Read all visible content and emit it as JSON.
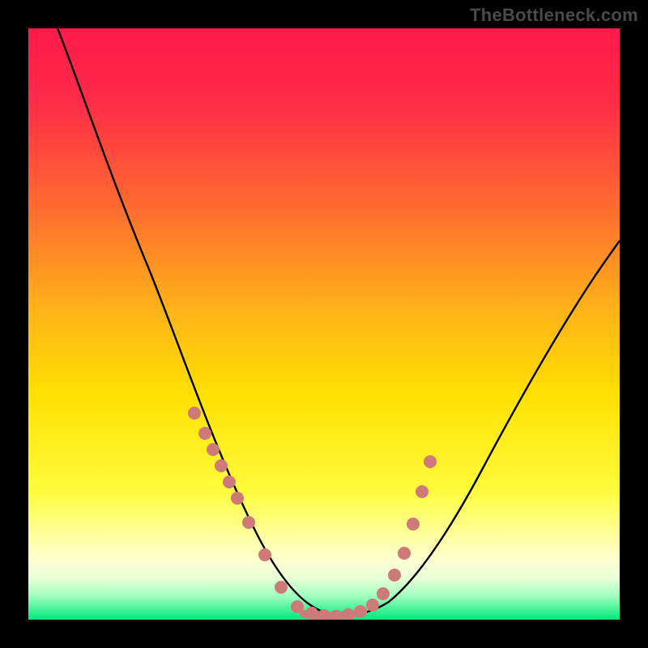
{
  "watermark": "TheBottleneck.com",
  "colors": {
    "background": "#000000",
    "gradient_top": "#ff1a4a",
    "gradient_mid": "#ffd400",
    "gradient_low": "#ffff8a",
    "gradient_bottom": "#00e87a",
    "curve": "#000000",
    "dot": "#cd7a78"
  },
  "chart_data": {
    "type": "line",
    "title": "",
    "xlabel": "",
    "ylabel": "",
    "xlim": [
      0,
      100
    ],
    "ylim": [
      0,
      100
    ],
    "series": [
      {
        "name": "bottleneck-curve",
        "x": [
          5,
          8,
          12,
          16,
          20,
          24,
          28,
          30,
          32,
          34,
          36,
          38,
          40,
          42,
          44,
          46,
          48,
          50,
          52,
          54,
          56,
          58,
          62,
          66,
          70,
          75,
          80,
          85,
          90,
          95,
          100
        ],
        "y": [
          100,
          94,
          86,
          78,
          70,
          62,
          52,
          47,
          42,
          36,
          30,
          24,
          18,
          12,
          7,
          3,
          1,
          0,
          0,
          0,
          1,
          3,
          8,
          14,
          21,
          30,
          39,
          47,
          54,
          60,
          65
        ]
      }
    ],
    "scatter_points": {
      "name": "highlight-dots",
      "x": [
        28,
        30,
        31.5,
        33,
        34.5,
        36,
        38,
        41,
        43,
        46,
        48,
        50,
        52,
        54,
        56,
        58,
        60,
        62,
        63.5,
        65,
        67
      ],
      "y": [
        35,
        32,
        29,
        26,
        24,
        21,
        16,
        9,
        5,
        1.5,
        0.6,
        0.4,
        0.4,
        0.5,
        0.8,
        2,
        5,
        9,
        14,
        20,
        26
      ]
    },
    "bottom_band_y": [
      0,
      1.2
    ]
  }
}
